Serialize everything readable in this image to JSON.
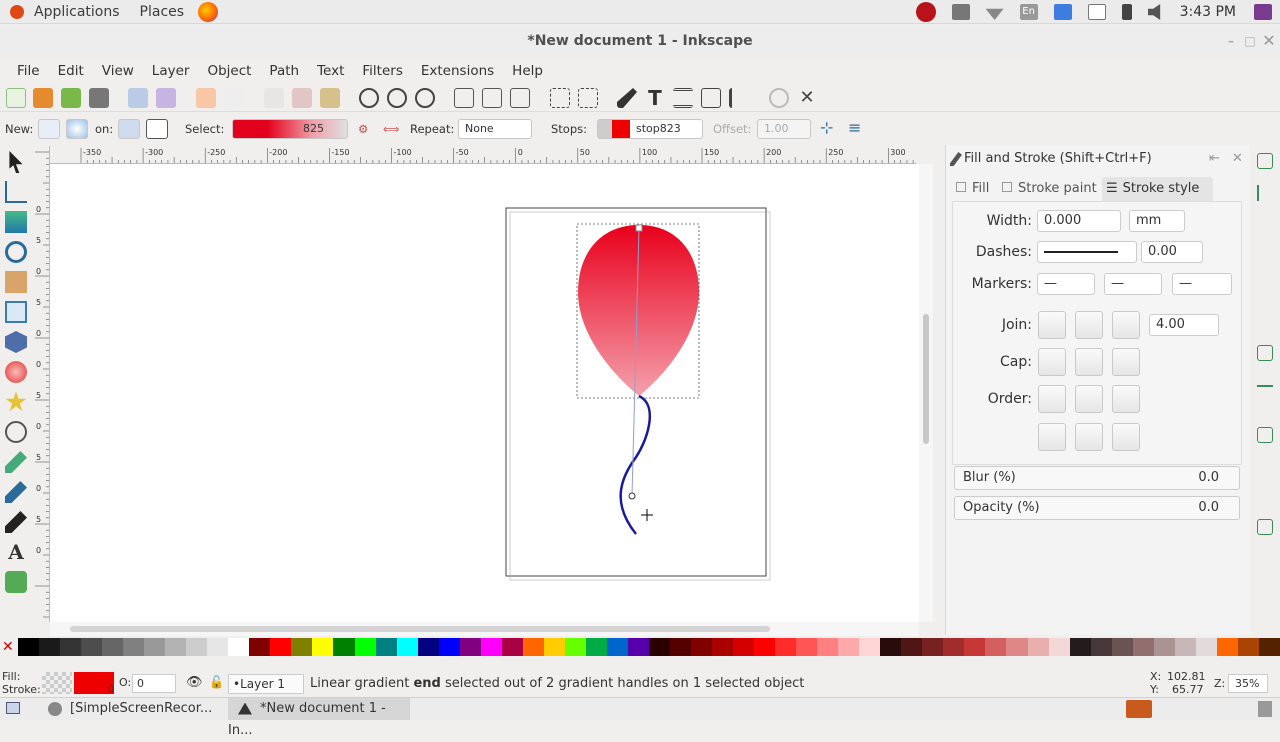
{
  "system_bar": {
    "applications": "Applications",
    "places": "Places",
    "keyboard": "En",
    "clock": "3:43 PM"
  },
  "window": {
    "title": "*New document 1 - Inkscape"
  },
  "menu": [
    "File",
    "Edit",
    "View",
    "Layer",
    "Object",
    "Path",
    "Text",
    "Filters",
    "Extensions",
    "Help"
  ],
  "controls": {
    "new_label": "New:",
    "on_label": "on:",
    "select_label": "Select:",
    "select_count": "825",
    "repeat_label": "Repeat:",
    "repeat_value": "None",
    "stops_label": "Stops:",
    "stop_value": "stop823",
    "offset_label": "Offset:",
    "offset_value": "1.00"
  },
  "ruler_labels": [
    "-350",
    "-300",
    "-250",
    "-200",
    "-150",
    "-100",
    "-50",
    "0",
    "50",
    "100",
    "150",
    "200",
    "250",
    "300"
  ],
  "vruler_labels": [
    "0",
    "5",
    "0",
    "5",
    "0",
    "0",
    "5",
    "0",
    "5",
    "0",
    "5",
    "0"
  ],
  "dock": {
    "title": "Fill and Stroke (Shift+Ctrl+F)",
    "tabs": {
      "fill": "Fill",
      "stroke_paint": "Stroke paint",
      "stroke_style": "Stroke style"
    },
    "width_label": "Width:",
    "width_value": "0.000",
    "unit": "mm",
    "dashes_label": "Dashes:",
    "dashes_value": "0.00",
    "markers_label": "Markers:",
    "join_label": "Join:",
    "join_value": "4.00",
    "cap_label": "Cap:",
    "order_label": "Order:",
    "blur_label": "Blur (%)",
    "blur_value": "0.0",
    "opacity_label": "Opacity (%)",
    "opacity_value": "0.0"
  },
  "palette": [
    "#000000",
    "#1a1a1a",
    "#333333",
    "#4d4d4d",
    "#666666",
    "#808080",
    "#999999",
    "#b3b3b3",
    "#cccccc",
    "#e6e6e6",
    "#ffffff",
    "#800000",
    "#ff0000",
    "#808000",
    "#ffff00",
    "#008000",
    "#00ff00",
    "#008080",
    "#00ffff",
    "#000080",
    "#0000ff",
    "#800080",
    "#ff00ff",
    "#aa0044",
    "#ff6600",
    "#ffcc00",
    "#66ff00",
    "#00aa44",
    "#0066cc",
    "#5500aa",
    "#2b0000",
    "#550000",
    "#800000",
    "#aa0000",
    "#d40000",
    "#ff0000",
    "#ff2a2a",
    "#ff5555",
    "#ff8080",
    "#ffaaaa",
    "#ffd5d5",
    "#280b0b",
    "#501616",
    "#782121",
    "#a02c2c",
    "#c83737",
    "#d35f5f",
    "#de8787",
    "#e9afaf",
    "#f4d7d7",
    "#241c1c",
    "#483737",
    "#6c5353",
    "#916f6f",
    "#ac9393",
    "#c8b7b7",
    "#e3dbdb",
    "#ff6600",
    "#aa4400",
    "#552200"
  ],
  "status": {
    "fill_label": "Fill:",
    "stroke_label": "Stroke:",
    "stroke_width": "0",
    "opacity_label": "O:",
    "opacity_value": "0",
    "layer": "•Layer 1",
    "msg_pre": "Linear gradient ",
    "msg_bold": "end",
    "msg_post": " selected out of 2 gradient handles on 1 selected object",
    "x_label": "X:",
    "x_value": "102.81",
    "y_label": "Y:",
    "y_value": "65.77",
    "zoom_label": "Z:",
    "zoom_value": "35%"
  },
  "taskbar": {
    "task1": "[SimpleScreenRecor...",
    "task2": "*New document 1 - In..."
  },
  "colors": {
    "balloon_top": "#e8001c",
    "balloon_bottom": "#f5a0ac",
    "string": "#1a1a9c",
    "accent": "#3e7ce0"
  }
}
